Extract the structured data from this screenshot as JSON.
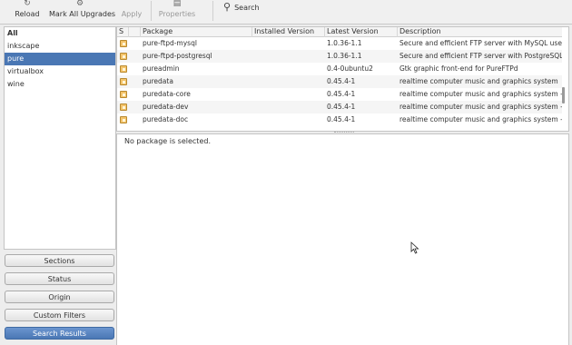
{
  "toolbar": {
    "reload_label": "Reload",
    "mark_all_label": "Mark All Upgrades",
    "apply_label": "Apply",
    "properties_label": "Properties",
    "search_label": "Search"
  },
  "sidebar": {
    "items": [
      {
        "label": "All",
        "bold": true
      },
      {
        "label": "inkscape"
      },
      {
        "label": "pure",
        "selected": true
      },
      {
        "label": "virtualbox"
      },
      {
        "label": "wine"
      }
    ]
  },
  "filters": {
    "sections": "Sections",
    "status": "Status",
    "origin": "Origin",
    "custom": "Custom Filters",
    "search_results": "Search Results"
  },
  "table": {
    "headers": {
      "status": "S",
      "package": "Package",
      "installed": "Installed Version",
      "latest": "Latest Version",
      "description": "Description"
    },
    "rows": [
      {
        "package": "pure-ftpd-mysql",
        "installed": "",
        "latest": "1.0.36-1.1",
        "description": "Secure and efficient FTP server with MySQL user a"
      },
      {
        "package": "pure-ftpd-postgresql",
        "installed": "",
        "latest": "1.0.36-1.1",
        "description": "Secure and efficient FTP server with PostgreSQL u:"
      },
      {
        "package": "pureadmin",
        "installed": "",
        "latest": "0.4-0ubuntu2",
        "description": "Gtk graphic front-end for PureFTPd"
      },
      {
        "package": "puredata",
        "installed": "",
        "latest": "0.45.4-1",
        "description": "realtime computer music and graphics system"
      },
      {
        "package": "puredata-core",
        "installed": "",
        "latest": "0.45.4-1",
        "description": "realtime computer music and graphics system - co"
      },
      {
        "package": "puredata-dev",
        "installed": "",
        "latest": "0.45.4-1",
        "description": "realtime computer music and graphics system - de"
      },
      {
        "package": "puredata-doc",
        "installed": "",
        "latest": "0.45.4-1",
        "description": "realtime computer music and graphics system - de"
      }
    ]
  },
  "details": {
    "message": "No package is selected."
  }
}
